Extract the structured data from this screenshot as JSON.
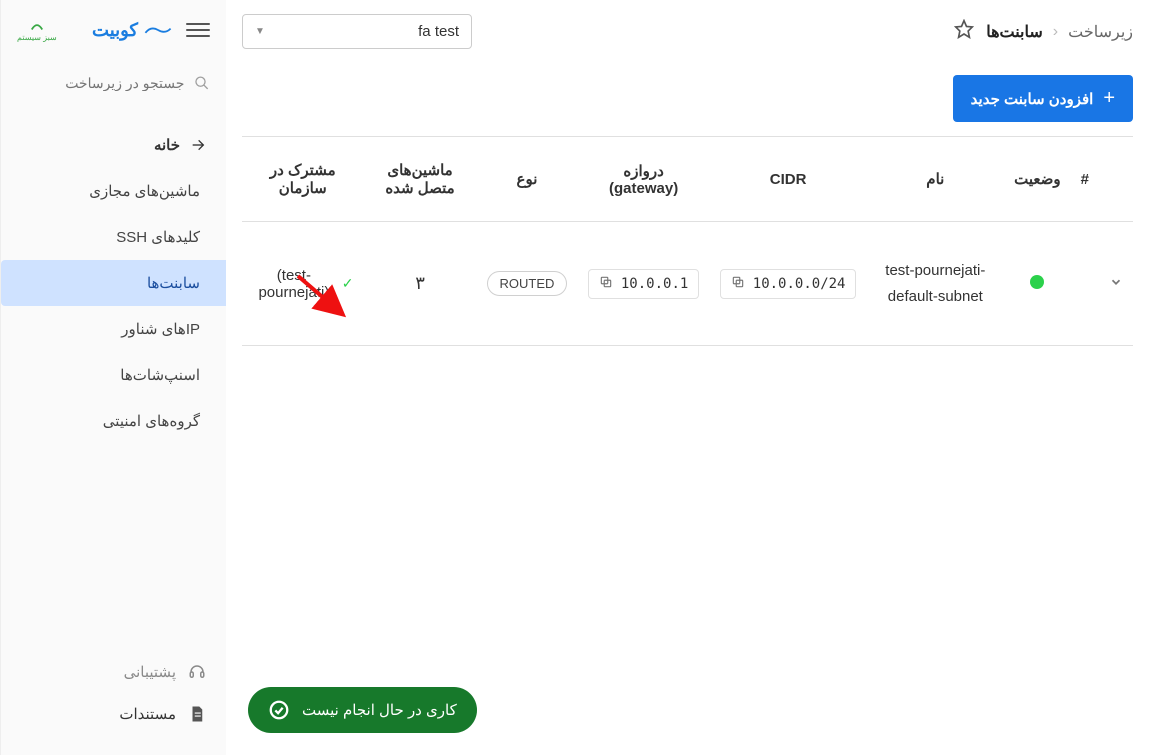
{
  "brand": {
    "name": "کوبیت"
  },
  "sidebar": {
    "search_placeholder": "جستجو در زیرساخت",
    "home_label": "خانه",
    "items": [
      {
        "label": "ماشین‌های مجازی"
      },
      {
        "label": "کلیدهای SSH"
      },
      {
        "label": "سابنت‌ها"
      },
      {
        "label": "IPهای شناور"
      },
      {
        "label": "اسنپ‌شات‌ها"
      },
      {
        "label": "گروه‌های امنیتی"
      }
    ],
    "support_label": "پشتیبانی",
    "docs_label": "مستندات"
  },
  "breadcrumbs": {
    "root": "زیرساخت",
    "current": "سابنت‌ها"
  },
  "org_select": {
    "value": "fa test"
  },
  "actions": {
    "add_subnet": "افزودن سابنت جدید"
  },
  "table": {
    "cols": {
      "idx": "#",
      "status": "وضعیت",
      "name": "نام",
      "cidr": "CIDR",
      "gateway": "دروازه (gateway)",
      "type": "نوع",
      "machines": "ماشین‌های متصل شده",
      "shared": "مشترک در سازمان"
    },
    "rows": [
      {
        "name": "test-pournejati-default-subnet",
        "cidr": "10.0.0.0/24",
        "gateway": "10.0.0.1",
        "type": "ROUTED",
        "machines": "۳",
        "shared_text": "test-) ✓\n(pournejati",
        "shared_ltr": "(test-pournejati)"
      }
    ]
  },
  "footer": {
    "no_task": "کاری در حال انجام نیست"
  }
}
